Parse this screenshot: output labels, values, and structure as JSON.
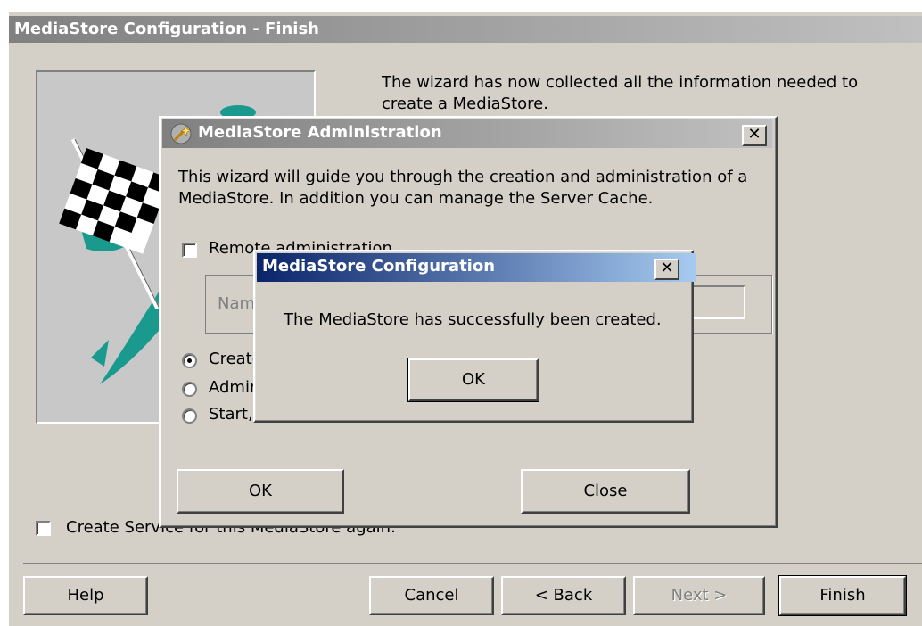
{
  "main_window": {
    "title": "MediaStore Configuration - Finish",
    "description_line1": "The wizard has now collected all the information needed to",
    "description_line2": "create a MediaStore.",
    "create_service_label": "Create Service for this MediaStore again.",
    "buttons": {
      "help": "Help",
      "cancel": "Cancel",
      "back": "< Back",
      "next": "Next >",
      "finish": "Finish"
    }
  },
  "admin_dialog": {
    "title": "MediaStore Administration",
    "close_glyph": "✕",
    "intro_line1": "This wizard will guide you through the creation  and administration of a",
    "intro_line2": "MediaStore. In addition you can manage the Server Cache.",
    "remote_admin_label": "Remote administration",
    "name_field_label": "Nam",
    "radio_options": [
      "Create",
      "Admin",
      "Start,"
    ],
    "selected_option_index": 0,
    "ok_label": "OK",
    "close_label": "Close"
  },
  "message_box": {
    "title": "MediaStore Configuration",
    "close_glyph": "✕",
    "message": "The MediaStore has successfully been created.",
    "ok_label": "OK"
  },
  "colors": {
    "titlebar_active_start": "#0a246a",
    "titlebar_active_end": "#a6caf0",
    "titlebar_inactive_start": "#808080",
    "titlebar_inactive_end": "#c0c0c0",
    "face": "#d4d0c8",
    "flag_teal": "#1a9a8f"
  }
}
